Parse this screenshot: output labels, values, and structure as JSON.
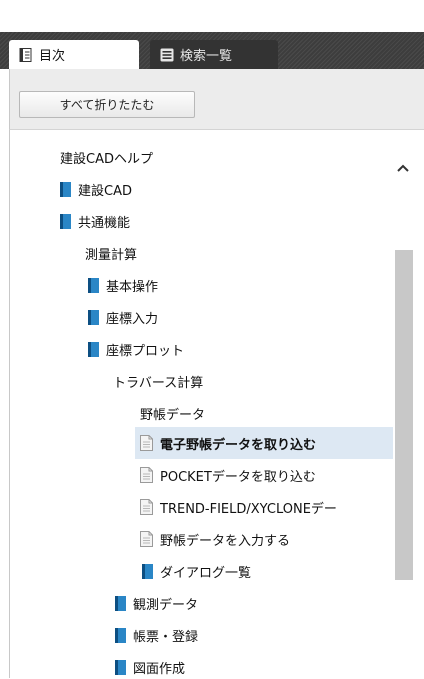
{
  "tabs": [
    {
      "label": "目次",
      "icon": "book-page-icon",
      "active": true
    },
    {
      "label": "検索一覧",
      "icon": "list-icon",
      "active": false
    }
  ],
  "toolbar": {
    "collapse_all_label": "すべて折りたたむ"
  },
  "tree": [
    {
      "label": "建設CADヘルプ",
      "icon": "none"
    },
    {
      "label": "建設CAD",
      "icon": "book-icon"
    },
    {
      "label": "共通機能",
      "icon": "book-icon"
    },
    {
      "label": "測量計算",
      "icon": "none"
    },
    {
      "label": "基本操作",
      "icon": "book-icon"
    },
    {
      "label": "座標入力",
      "icon": "book-icon"
    },
    {
      "label": "座標プロット",
      "icon": "book-icon"
    },
    {
      "label": "トラバース計算",
      "icon": "none"
    },
    {
      "label": "野帳データ",
      "icon": "none"
    },
    {
      "label": "電子野帳データを取り込む",
      "icon": "page-icon",
      "selected": true
    },
    {
      "label": "POCKETデータを取り込む",
      "icon": "page-icon"
    },
    {
      "label": "TREND-FIELD/XYCLONEデー",
      "icon": "page-icon"
    },
    {
      "label": "野帳データを入力する",
      "icon": "page-icon"
    },
    {
      "label": "ダイアログ一覧",
      "icon": "book-icon"
    },
    {
      "label": "観測データ",
      "icon": "book-icon"
    },
    {
      "label": "帳票・登録",
      "icon": "book-icon"
    },
    {
      "label": "図面作成",
      "icon": "book-icon"
    }
  ],
  "scrollbar": {
    "up_icon": "chevron-up-icon"
  }
}
